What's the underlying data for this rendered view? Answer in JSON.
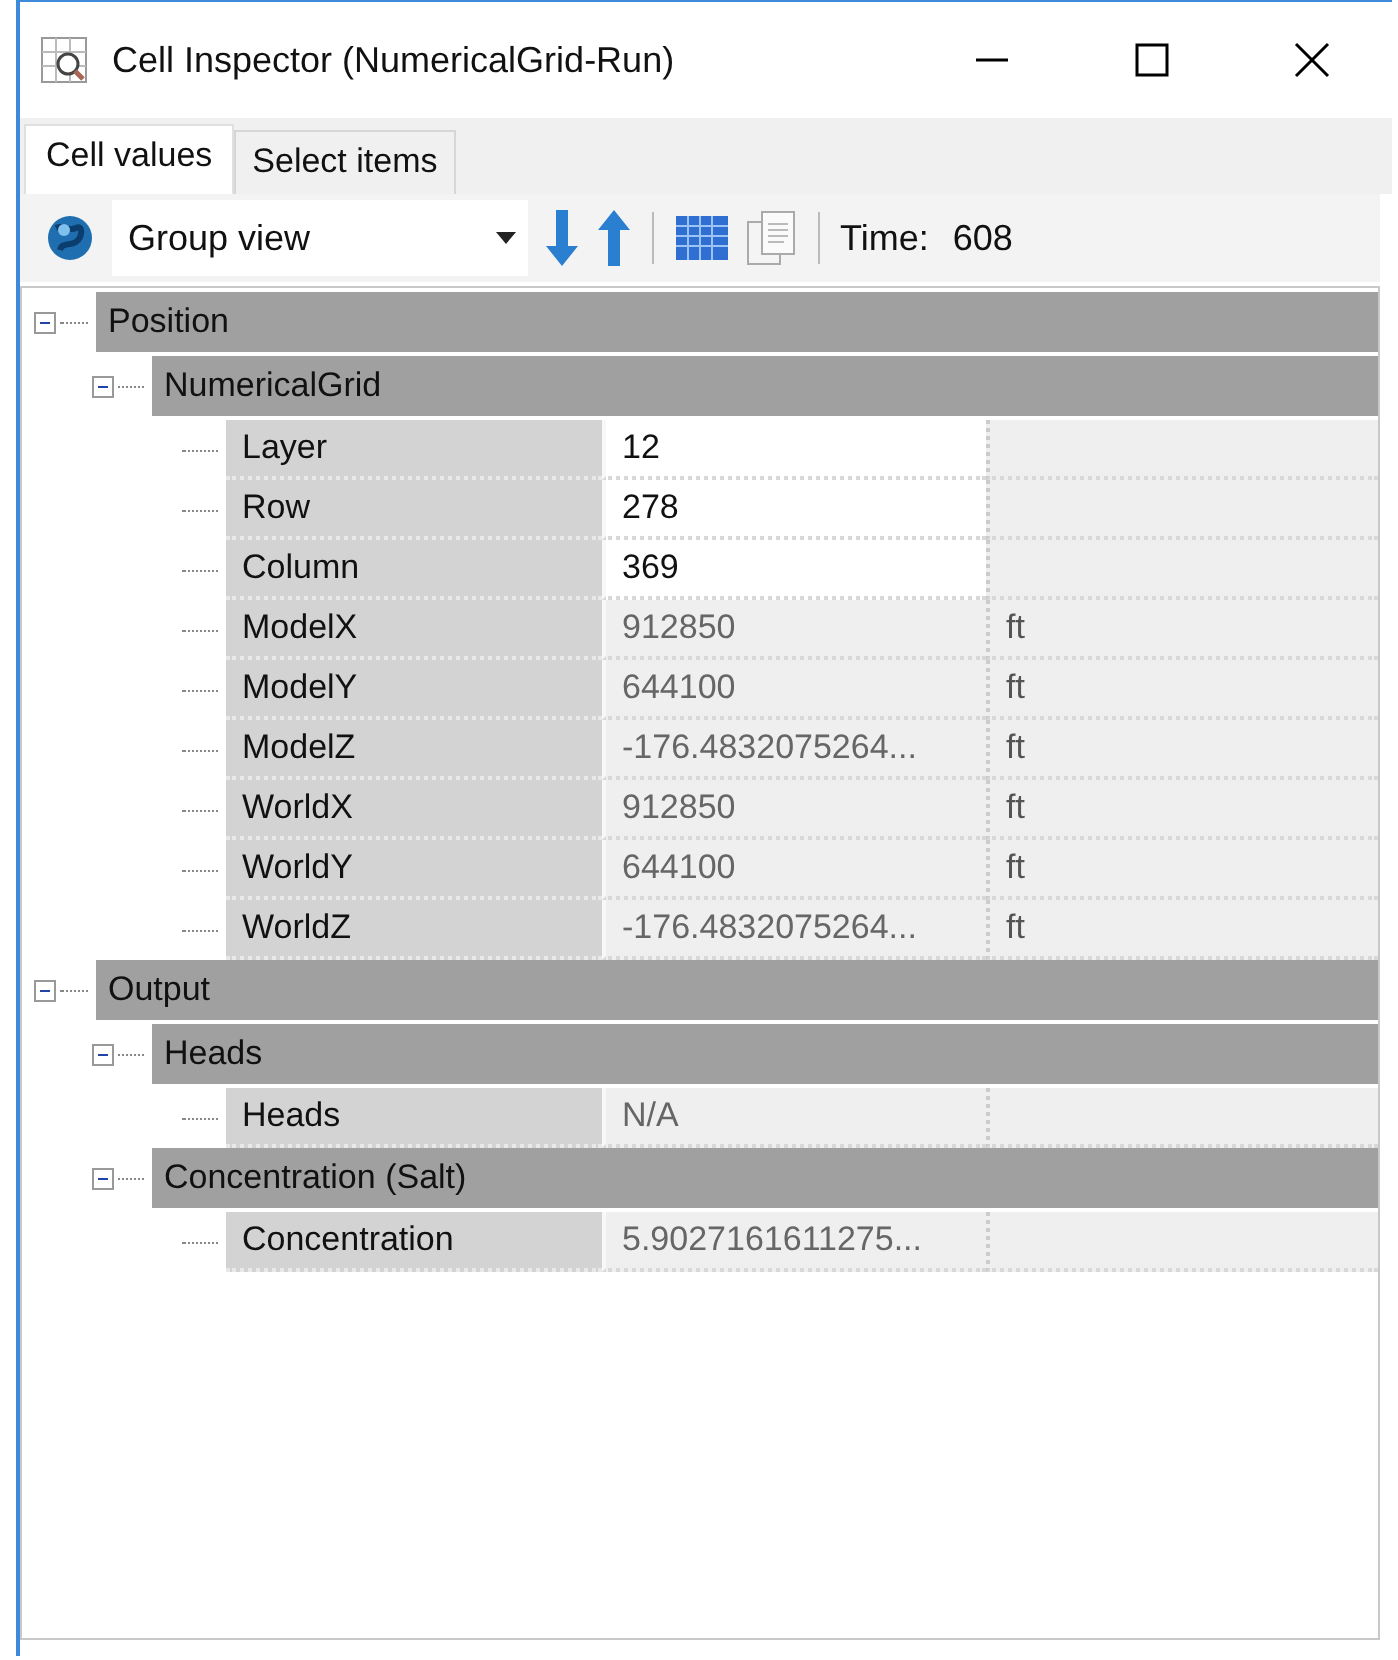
{
  "window": {
    "title": "Cell Inspector (NumericalGrid-Run)"
  },
  "tabs": [
    {
      "label": "Cell values",
      "selected": true
    },
    {
      "label": "Select items",
      "selected": false
    }
  ],
  "toolbar": {
    "view": "Group view",
    "time_label": "Time:",
    "time_value": "608"
  },
  "tree": [
    {
      "label": "Position",
      "expanded": true,
      "children": [
        {
          "label": "NumericalGrid",
          "expanded": true,
          "rows": [
            {
              "name": "Layer",
              "value": "12",
              "editable": true
            },
            {
              "name": "Row",
              "value": "278",
              "editable": true
            },
            {
              "name": "Column",
              "value": "369",
              "editable": true
            },
            {
              "name": "ModelX",
              "value": "912850",
              "unit": "ft",
              "editable": false
            },
            {
              "name": "ModelY",
              "value": "644100",
              "unit": "ft",
              "editable": false
            },
            {
              "name": "ModelZ",
              "value": "-176.4832075264...",
              "unit": "ft",
              "editable": false
            },
            {
              "name": "WorldX",
              "value": "912850",
              "unit": "ft",
              "editable": false
            },
            {
              "name": "WorldY",
              "value": "644100",
              "unit": "ft",
              "editable": false
            },
            {
              "name": "WorldZ",
              "value": "-176.4832075264...",
              "unit": "ft",
              "editable": false
            }
          ]
        }
      ]
    },
    {
      "label": "Output",
      "expanded": true,
      "children": [
        {
          "label": "Heads",
          "expanded": true,
          "rows": [
            {
              "name": "Heads",
              "value": "N/A",
              "editable": false
            }
          ]
        },
        {
          "label": "Concentration (Salt)",
          "expanded": true,
          "rows": [
            {
              "name": "Concentration",
              "value": "5.9027161611275...",
              "editable": false
            }
          ]
        }
      ]
    }
  ]
}
